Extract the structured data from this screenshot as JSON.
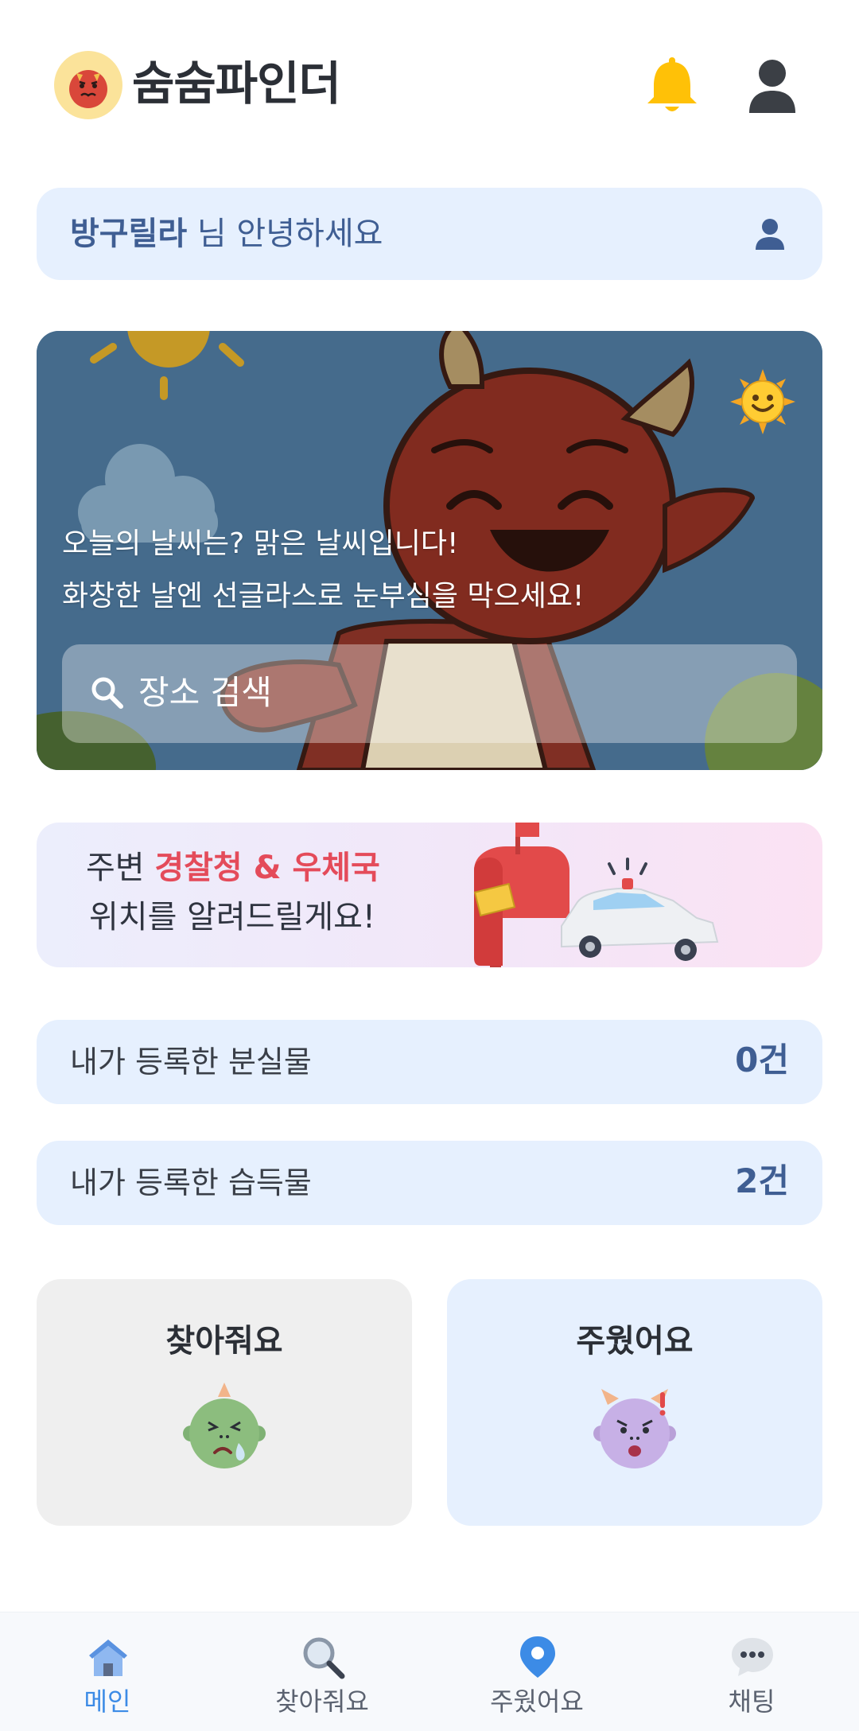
{
  "header": {
    "app_title": "숨숨파인더",
    "logo_icon": "red-goblin-logo-icon",
    "notification_icon": "bell-icon",
    "profile_icon": "user-icon"
  },
  "greeting": {
    "user_name": "방구릴라",
    "suffix": " 님 안녕하세요",
    "icon": "user-icon"
  },
  "weather": {
    "line1": "오늘의 날씨는? 맑은 날씨입니다!",
    "line2": "화창한 날엔 선글라스로 눈부심을 막으세요!",
    "weather_icon": "sun-emoji-icon"
  },
  "search": {
    "placeholder": "장소 검색",
    "icon": "search-icon"
  },
  "notice": {
    "prefix": "주변 ",
    "highlight": "경찰청 & 우체국",
    "line2": "위치를 알려드릴게요!",
    "highlight_color": "#e44b5a"
  },
  "stats": {
    "lost_label": "내가 등록한 분실물",
    "lost_value": "0건",
    "found_label": "내가 등록한 습득물",
    "found_value": "2건"
  },
  "actions": {
    "find_label": "찾아줘요",
    "found_label": "주웠어요"
  },
  "nav": {
    "items": [
      {
        "label": "메인",
        "icon": "home-icon",
        "active": true
      },
      {
        "label": "찾아줘요",
        "icon": "magnifier-icon",
        "active": false
      },
      {
        "label": "주웠어요",
        "icon": "location-pin-icon",
        "active": false
      },
      {
        "label": "채팅",
        "icon": "chat-bubble-icon",
        "active": false
      }
    ],
    "active_color": "#3c8be6"
  },
  "colors": {
    "accent": "#3f5e93",
    "card_bg": "#e6f0fe",
    "warning_yellow": "#ffc107"
  }
}
